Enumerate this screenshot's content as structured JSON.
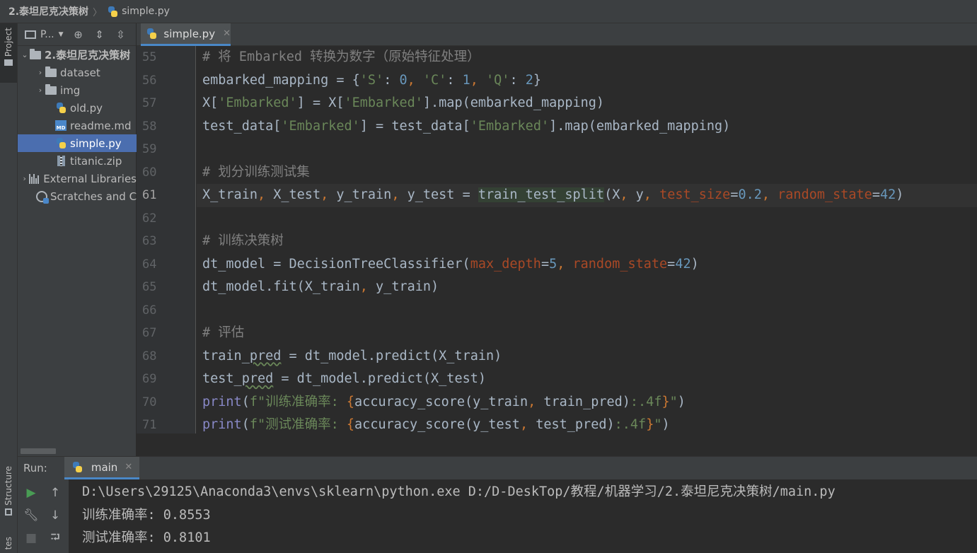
{
  "breadcrumb": {
    "project": "2.泰坦尼克决策树",
    "file": "simple.py"
  },
  "left_strip": {
    "project_tab": "Project",
    "structure_tab": "Structure",
    "favorites_tab": "tes"
  },
  "project_panel": {
    "title": "P...",
    "items": [
      {
        "label": "2.泰坦尼克决策树",
        "icon": "folder-icon",
        "expanded": true
      },
      {
        "label": "dataset",
        "icon": "folder-icon"
      },
      {
        "label": "img",
        "icon": "folder-icon"
      },
      {
        "label": "old.py",
        "icon": "python-file-icon"
      },
      {
        "label": "readme.md",
        "icon": "markdown-file-icon"
      },
      {
        "label": "simple.py",
        "icon": "python-file-icon",
        "selected": true
      },
      {
        "label": "titanic.zip",
        "icon": "zip-file-icon"
      },
      {
        "label": "External Libraries",
        "icon": "library-icon"
      },
      {
        "label": "Scratches and Consoles",
        "icon": "scratch-icon"
      }
    ]
  },
  "editor": {
    "tab_label": "simple.py",
    "current_line": "61",
    "line_numbers": [
      "55",
      "56",
      "57",
      "58",
      "59",
      "60",
      "61",
      "62",
      "63",
      "64",
      "65",
      "66",
      "67",
      "68",
      "69",
      "70",
      "71"
    ]
  },
  "code": {
    "l55": {
      "comment": "# 将 Embarked 转换为数字（原始特征处理）"
    },
    "l56": {
      "var": "embarked_mapping = {",
      "s1": "'S'",
      "c1": ": ",
      "n1": "0",
      "sep1": ", ",
      "s2": "'C'",
      "c2": ": ",
      "n2": "1",
      "sep2": ", ",
      "s3": "'Q'",
      "c3": ": ",
      "n3": "2",
      "end": "}"
    },
    "l57": {
      "a": "X[",
      "s1": "'Embarked'",
      "b": "] = X[",
      "s2": "'Embarked'",
      "c": "].map(embarked_mapping)"
    },
    "l58": {
      "a": "test_data[",
      "s1": "'Embarked'",
      "b": "] = test_data[",
      "s2": "'Embarked'",
      "c": "].map(embarked_mapping)"
    },
    "l60": {
      "comment": "# 划分训练测试集"
    },
    "l61": {
      "v1": "X_train",
      "c1": ", ",
      "v2": "X_test",
      "c2": ", ",
      "v3": "y_train",
      "c3": ", ",
      "v4": "y_test",
      "eq": " = ",
      "fn": "train_test_split",
      "open": "(X",
      "c4": ", ",
      "y": "y",
      "c5": ", ",
      "p1": "test_size",
      "eq1": "=",
      "n1": "0.2",
      "c6": ", ",
      "p2": "random_state",
      "eq2": "=",
      "n2": "42",
      "close": ")"
    },
    "l63": {
      "comment": "# 训练决策树"
    },
    "l64": {
      "a": "dt_model = DecisionTreeClassifier(",
      "p1": "max_depth",
      "eq1": "=",
      "n1": "5",
      "c1": ", ",
      "p2": "random_state",
      "eq2": "=",
      "n2": "42",
      "close": ")"
    },
    "l65": {
      "a": "dt_model.fit(X_train",
      "c1": ", ",
      "b": "y_train)"
    },
    "l67": {
      "comment": "# 评估"
    },
    "l68": {
      "a": "train_",
      "u": "pred",
      "b": " = dt_model.predict(X_train)"
    },
    "l69": {
      "a": "test_",
      "u": "pred",
      "b": " = dt_model.predict(X_test)"
    },
    "l70": {
      "fn": "print",
      "open": "(",
      "s1": "f\"训练准确率: ",
      "br1": "{",
      "a": "accuracy_score(y_train",
      "c1": ", ",
      "b": "train_pred)",
      "fmt": ":.4f",
      "br2": "}",
      "s2": "\"",
      "close": ")"
    },
    "l71": {
      "fn": "print",
      "open": "(",
      "s1": "f\"测试准确率: ",
      "br1": "{",
      "a": "accuracy_score(y_test",
      "c1": ", ",
      "b": "test_pred)",
      "fmt": ":.4f",
      "br2": "}",
      "s2": "\"",
      "close": ")"
    }
  },
  "run": {
    "label": "Run:",
    "tab_label": "main",
    "console_lines": [
      "D:\\Users\\29125\\Anaconda3\\envs\\sklearn\\python.exe D:/D-DeskTop/教程/机器学习/2.泰坦尼克决策树/main.py",
      "训练准确率: 0.8553",
      "测试准确率: 0.8101"
    ]
  }
}
